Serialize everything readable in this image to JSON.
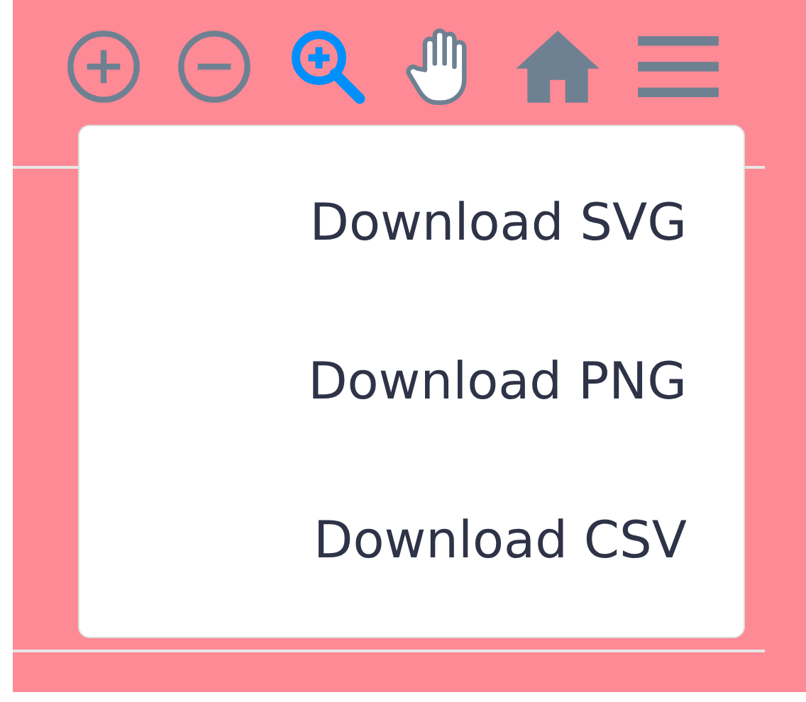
{
  "toolbar": [
    {
      "kind": "zoom-in",
      "selected": false
    },
    {
      "kind": "zoom-out",
      "selected": false
    },
    {
      "kind": "zoom-select",
      "selected": true
    },
    {
      "kind": "pan",
      "selected": false
    },
    {
      "kind": "home",
      "selected": false
    },
    {
      "kind": "menu",
      "selected": false
    }
  ],
  "menu": {
    "items": [
      {
        "label": "Download SVG"
      },
      {
        "label": "Download PNG"
      },
      {
        "label": "Download CSV"
      }
    ]
  }
}
